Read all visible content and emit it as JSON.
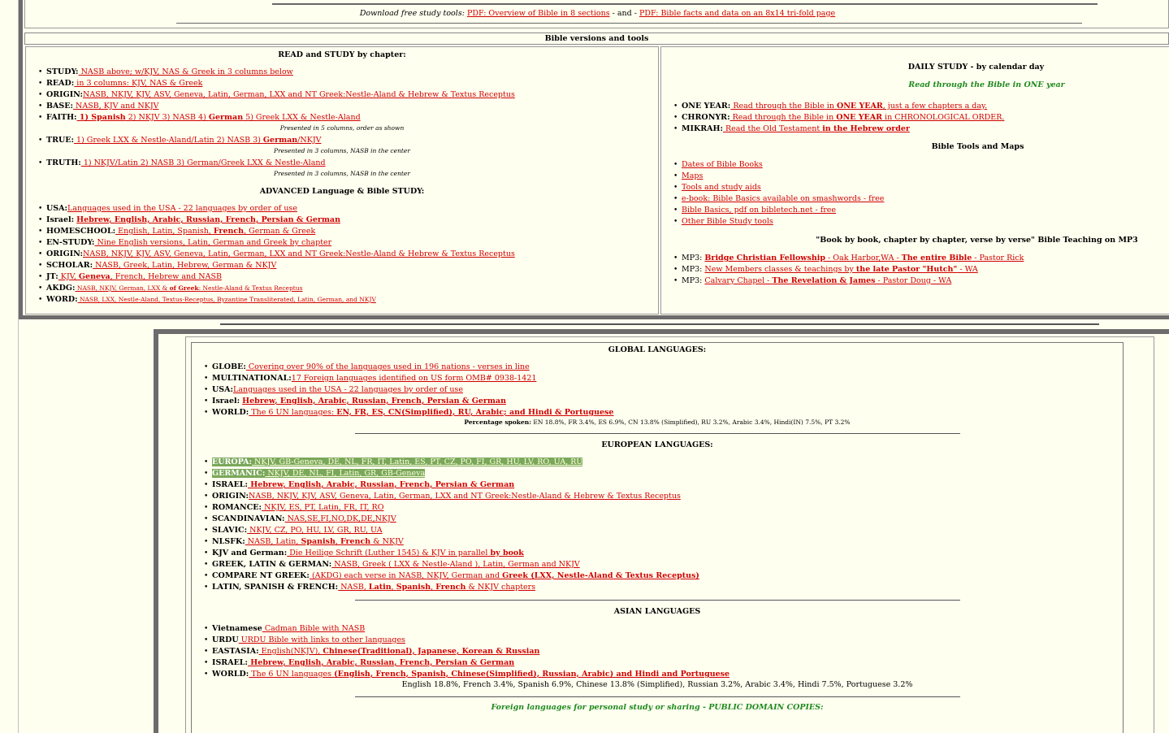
{
  "top": {
    "download_prefix": "Download free study tools:",
    "download_link1": "PDF: Overview of Bible in 8 sections",
    "download_and": " - and - ",
    "download_link2": "PDF: Bible facts and data on an 8x14 tri-fold page"
  },
  "versions_heading": "Bible versions and tools",
  "read_study": {
    "heading": "READ and STUDY by chapter:",
    "items": [
      {
        "label": "STUDY:",
        "link": " NASB above; w/KJV, NAS & Greek in 3 columns below"
      },
      {
        "label": "READ:",
        "link": " in 3 columns: KJV, NAS & Greek"
      },
      {
        "label": "ORIGIN:",
        "link": "NASB, NKJV, KJV, ASV, Geneva, Latin, German, LXX and NT Greek:Nestle-Aland & Hebrew & Textus Receptus"
      },
      {
        "label": "BASE:",
        "link": " NASB, KJV and NKJV"
      }
    ],
    "faith": {
      "label": "FAITH:",
      "p1": " 1) Spanish",
      "p2": " 2) NKJV 3) NASB 4) ",
      "p3": "German",
      "p4": " 5) Greek LXX & Nestle-Aland",
      "note": "Presented in 5 columns, order as shown"
    },
    "true": {
      "label": "TRUE:",
      "p1": " 1) Greek LXX & Nestle-Aland/Latin 2) NASB 3) ",
      "p2": "German",
      "p3": "/NKJV",
      "note": "Presented in 3 columns, NASB in the center"
    },
    "truth": {
      "label": "TRUTH:",
      "p1": " 1) NKJV/Latin 2) NASB 3) German/Greek LXX & Nestle-Aland",
      "note": "Presented in 3 columns, NASB in the center"
    }
  },
  "advanced": {
    "heading": "ADVANCED Language & Bible STUDY:",
    "usa": {
      "label": "USA:",
      "link": "Languages used in the USA - 22 languages by order of use"
    },
    "israel": {
      "label": "Israel:",
      "link": "Hebrew, English, Arabic, Russian, French, Persian & German"
    },
    "homeschool": {
      "label": "HOMESCHOOL:",
      "p1": " English, Latin, Spanish, ",
      "p2": "French",
      "p3": ", German & Greek"
    },
    "enstudy": {
      "label": "EN-STUDY:",
      "link": " Nine English versions, Latin, German and Greek by chapter"
    },
    "origin": {
      "label": "ORIGIN:",
      "link": "NASB, NKJV, KJV, ASV, Geneva, Latin, German, LXX and NT Greek:Nestle-Aland & Hebrew & Textus Receptus"
    },
    "scholar": {
      "label": "SCHOLAR:",
      "link": " NASB, Greek, Latin, Hebrew, German & NKJV"
    },
    "jt": {
      "label": "JT:",
      "p1": " KJV, ",
      "p2": "Geneva",
      "p3": ", French, Hebrew and NASB"
    },
    "akdg": {
      "label": "AKDG:",
      "p1": " NASB, NKJV, German, LXX & ",
      "p2": "of Greek",
      "p3": ": Nestle-Aland & Textus Receptus"
    },
    "word": {
      "label": "WORD:",
      "link": " NASB, LXX, Nestle-Aland, Textus-Receptus, Byzantine Transliterated, Latin, German, and NKJV"
    }
  },
  "daily": {
    "heading": "DAILY STUDY - by calendar day",
    "subheading": "Read through the Bible in ONE year",
    "oneyear": {
      "label": "ONE YEAR:",
      "p1": " Read through the Bible in ",
      "p2": "ONE YEAR",
      "p3": ", just a few chapters a day."
    },
    "chronyr": {
      "label": "CHRONYR:",
      "p1": " Read through the Bible in ",
      "p2": "ONE YEAR",
      "p3": " in CHRONOLOGICAL ORDER."
    },
    "mikrah": {
      "label": "MIKRAH:",
      "p1": " Read the Old Testament ",
      "p2": "in the Hebrew order"
    }
  },
  "tools": {
    "heading": "Bible Tools and Maps",
    "items": [
      "Dates of Bible Books",
      "Maps",
      "Tools and study aids",
      "e-book: Bible Basics available on smashwords - free",
      "Bible Basics, pdf on bibletech.net - free",
      "Other Bible Study tools"
    ]
  },
  "mp3": {
    "heading": "\"Book by book, chapter by chapter, verse by verse\" Bible Teaching on MP3",
    "label": "MP3:",
    "i1": {
      "p1": "Bridge Christian Fellowship",
      "p2": " - Oak Harbor,WA - ",
      "p3": "The entire Bible",
      "p4": " - Pastor Rick"
    },
    "i2": {
      "p1": "New Members classes & teachings by ",
      "p2": "the late Pastor \"Hutch\"",
      "p3": " - WA"
    },
    "i3": {
      "p1": "Calvary Chapel - ",
      "p2": "The Revelation & James",
      "p3": " - Pastor Doug - WA"
    }
  },
  "global": {
    "heading": "GLOBAL LANGUAGES:",
    "globe": {
      "label": "GLOBE:",
      "link": " Covering over 90% of the languages used in 196 nations - verses in line"
    },
    "multi": {
      "label": "MULTINATIONAL:",
      "link": "17 Foreign languages identified on US form OMB# 0938-1421"
    },
    "usa": {
      "label": "USA:",
      "link": "Languages used in the USA - 22 languages by order of use"
    },
    "israel": {
      "label": "Israel:",
      "link": "Hebrew, English, Arabic, Russian, French, Persian & German"
    },
    "world": {
      "label": "WORLD:",
      "p1": " The 6 UN languages: ",
      "p2": "EN, FR, ES, CN(Simplified), RU, Arabic; and Hindi & Portuguese"
    },
    "pct_label": "Percentage spoken:",
    "pct_text": " EN 18.8%, FR 3.4%, ES 6.9%, CN 13.8% (Simplified), RU 3.2%, Arabic 3.4%, Hindi(IN) 7.5%, PT 3.2%"
  },
  "european": {
    "heading": "EUROPEAN LANGUAGES:",
    "europa": {
      "label": "EUROPA:",
      "link": " NKJV, GB-Geneva, DE, NL, FR, IT, Latin, ES, PT, CZ, PO, FI, GR, HU, LV, RO, UA, RU"
    },
    "germanic": {
      "label": "GERMANIC:",
      "link": " NKJV, DE, NL, FI, Latin, GR, GB-Geneva"
    },
    "israel": {
      "label": "ISRAEL:",
      "link": " Hebrew, English, Arabic, Russian, French, Persian & German"
    },
    "origin": {
      "label": "ORIGIN:",
      "link": "NASB, NKJV, KJV, ASV, Geneva, Latin, German, LXX and NT Greek:Nestle-Aland & Hebrew & Textus Receptus"
    },
    "romance": {
      "label": "ROMANCE:",
      "link": " NKJV, ES, PT, Latin, FR, IT, RO"
    },
    "scand": {
      "label": "SCANDINAVIAN:",
      "link": " NAS,SE,FI,NO,DK,DE,NKJV"
    },
    "slavic": {
      "label": "SLAVIC:",
      "link": " NKJV, CZ, PO, HU, LV, GR, RU, UA"
    },
    "nlsfk": {
      "label": "NLSFK:",
      "p1": " NASB, Latin, ",
      "p2": "Spanish",
      "p3": ", ",
      "p4": "French",
      "p5": " & NKJV"
    },
    "kjvger": {
      "label": "KJV and German:",
      "p1": " Die Heilige Schrift (Luther 1545) & KJV in parallel ",
      "p2": "by book"
    },
    "glg": {
      "label": "GREEK, LATIN & GERMAN:",
      "link": " NASB, Greek ( LXX & Nestle-Aland ), Latin, German and NKJV"
    },
    "cntg": {
      "label": "COMPARE NT GREEK:",
      "p1": " (AKDG) each verse in NASB, NKJV, German and ",
      "p2": "Greek (LXX, Nestle-Aland & Textus Receptus)"
    },
    "lsf": {
      "label": "LATIN, SPANISH & FRENCH:",
      "p1": " NASB, ",
      "p2": "Latin",
      "p3": ", ",
      "p4": "Spanish",
      "p5": ", ",
      "p6": "French",
      "p7": " & NKJV chapters"
    }
  },
  "asian": {
    "heading": "ASIAN LANGUAGES",
    "viet": {
      "label": "Vietnamese",
      "link": " Cadman Bible with NASB"
    },
    "urdu": {
      "label": "URDU",
      "link": " URDU Bible with links to other languages"
    },
    "eastasia": {
      "label": "EASTASIA:",
      "p1": " English(NKJV), ",
      "p2": "Chinese(Traditional), Japanese, Korean & Russian"
    },
    "israel": {
      "label": "ISRAEL:",
      "link": " Hebrew, English, Arabic, Russian, French, Persian & German"
    },
    "world": {
      "label": "WORLD:",
      "p1": " The 6 UN languages ",
      "p2": "(English, French, Spanish, Chinese(Simplified), Russian, Arabic) and Hindi and Portuguese"
    },
    "pct_text": "English 18.8%, French 3.4%, Spanish 6.9%, Chinese 13.8% (Simplified), Russian 3.2%, Arabic 3.4%, Hindi 7.5%, Portuguese 3.2%"
  },
  "foreign_footer": "Foreign languages for personal study or sharing - PUBLIC DOMAIN COPIES:"
}
